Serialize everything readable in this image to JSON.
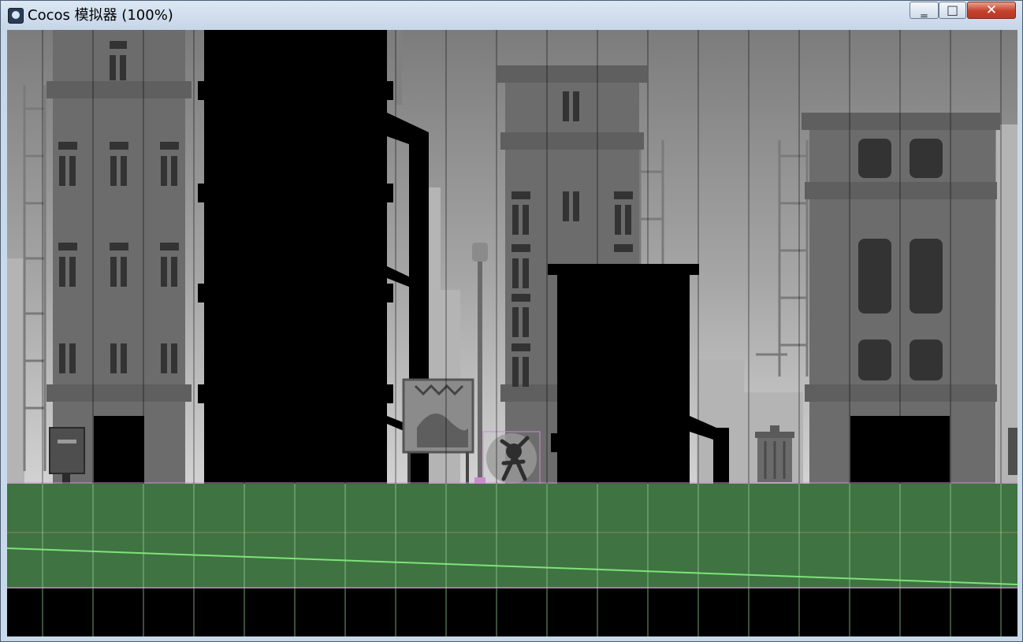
{
  "window": {
    "title": "Cocos 模拟器 (100%)",
    "controls": {
      "minimize": "‗",
      "maximize": "□",
      "close": "✕"
    }
  },
  "game": {
    "theme": "grayscale pixel-art city street",
    "ground_color": "#3f7341",
    "underground_color": "#000000",
    "debug_line_color": "#c98ccf",
    "grid_line_color": "#9ed39c",
    "slope_line_color": "#7ee37a",
    "player": "stick-figure character in round bubble"
  }
}
